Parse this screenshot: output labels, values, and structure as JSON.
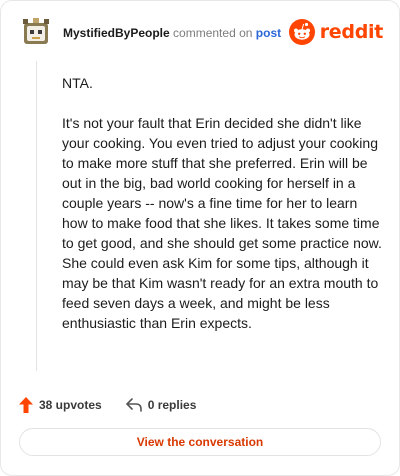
{
  "header": {
    "username": "MystifiedByPeople",
    "action": "commented on",
    "target": "post",
    "brand": "reddit"
  },
  "comment": {
    "paragraphs": [
      "NTA.",
      "It's not your fault that Erin decided she didn't like your cooking. You even tried to adjust your cooking to make more stuff that she preferred. Erin will be out in the big, bad world cooking for herself in a couple years -- now's a fine time for her to learn how to make food that she likes. It takes some time to get good, and she should get some practice now. She could even ask Kim for some tips, although it may be that Kim wasn't ready for an extra mouth to feed seven days a week, and might be less enthusiastic than Erin expects."
    ]
  },
  "footer": {
    "upvotes": "38 upvotes",
    "replies": "0 replies"
  },
  "cta": {
    "label": "View the conversation"
  },
  "colors": {
    "brand": "#ff4500",
    "cta": "#d93900",
    "link": "#2a66d9",
    "upvote": "#ff4500"
  },
  "icons": [
    "avatar-snoo",
    "reddit-logo-icon",
    "upvote-arrow-icon",
    "reply-icon"
  ]
}
